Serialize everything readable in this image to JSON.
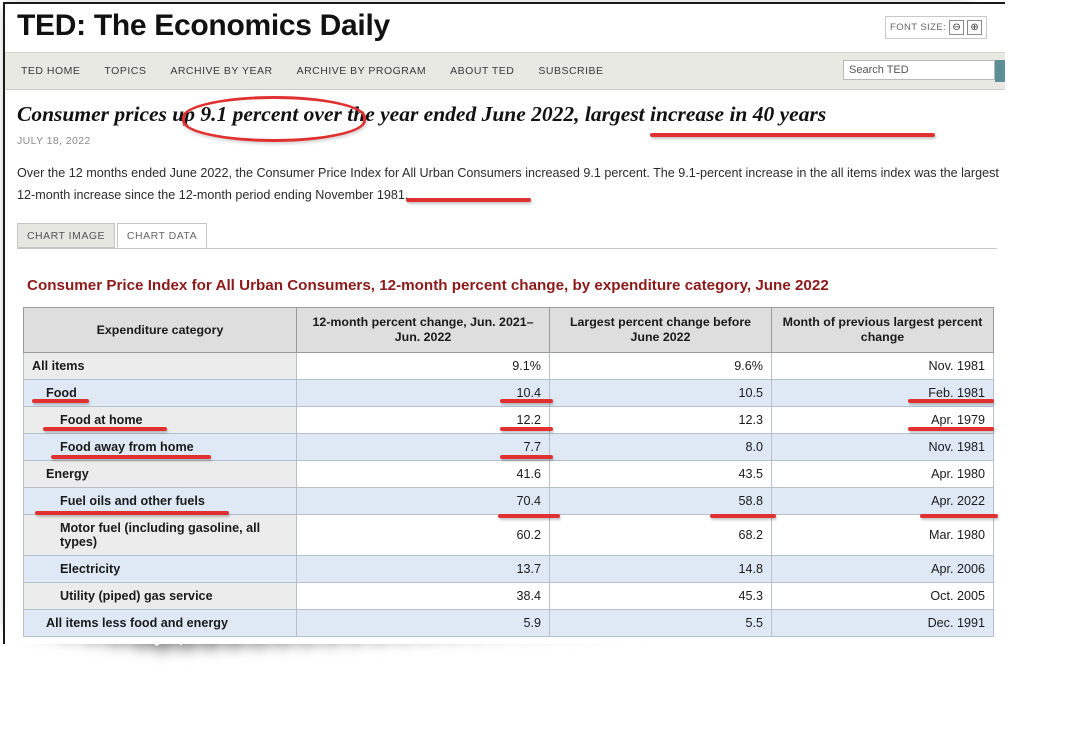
{
  "site": {
    "title": "TED: The Economics Daily",
    "font_size_label": "FONT SIZE:",
    "font_size_decrease": "⊖",
    "font_size_increase": "⊕",
    "nav": [
      "TED HOME",
      "TOPICS",
      "ARCHIVE BY YEAR",
      "ARCHIVE BY PROGRAM",
      "ABOUT TED",
      "SUBSCRIBE"
    ],
    "search": {
      "value": "Search TED",
      "placeholder": "Search TED",
      "button_icon": "search-icon",
      "button_glyph": "◔"
    }
  },
  "article": {
    "headline": "Consumer prices up 9.1 percent over the year ended June 2022, largest increase in 40 years",
    "date": "JULY 18, 2022",
    "body": "Over the 12 months ended June 2022, the Consumer Price Index for All Urban Consumers increased 9.1 percent. The 9.1-percent increase in the all items index was the largest 12-month increase since the 12-month period ending November 1981."
  },
  "tabs": [
    {
      "label": "CHART IMAGE",
      "active": false
    },
    {
      "label": "CHART DATA",
      "active": true
    }
  ],
  "chart_data": {
    "type": "table",
    "title": "Consumer Price Index for All Urban Consumers, 12-month percent change, by expenditure category, June 2022",
    "columns": [
      "Expenditure category",
      "12-month percent change, Jun. 2021–Jun. 2022",
      "Largest percent change before June 2022",
      "Month of previous largest percent change"
    ],
    "rows": [
      {
        "category": "All items",
        "indent": 0,
        "change": "9.1%",
        "largest": "9.6%",
        "month": "Nov. 1981"
      },
      {
        "category": "Food",
        "indent": 1,
        "change": "10.4",
        "largest": "10.5",
        "month": "Feb. 1981"
      },
      {
        "category": "Food at home",
        "indent": 2,
        "change": "12.2",
        "largest": "12.3",
        "month": "Apr. 1979"
      },
      {
        "category": "Food away from home",
        "indent": 2,
        "change": "7.7",
        "largest": "8.0",
        "month": "Nov. 1981"
      },
      {
        "category": "Energy",
        "indent": 1,
        "change": "41.6",
        "largest": "43.5",
        "month": "Apr. 1980"
      },
      {
        "category": "Fuel oils and other fuels",
        "indent": 2,
        "change": "70.4",
        "largest": "58.8",
        "month": "Apr. 2022"
      },
      {
        "category": "Motor fuel (including gasoline, all types)",
        "indent": 2,
        "change": "60.2",
        "largest": "68.2",
        "month": "Mar. 1980"
      },
      {
        "category": "Electricity",
        "indent": 2,
        "change": "13.7",
        "largest": "14.8",
        "month": "Apr. 2006"
      },
      {
        "category": "Utility (piped) gas service",
        "indent": 2,
        "change": "38.4",
        "largest": "45.3",
        "month": "Oct. 2005"
      },
      {
        "category": "All items less food and energy",
        "indent": 1,
        "change": "5.9",
        "largest": "5.5",
        "month": "Dec. 1991"
      }
    ]
  },
  "annotations": {
    "accent_color": "#e03030",
    "marks": [
      "ellipse-9-1-percent",
      "underline-largest-increase-in-40-years",
      "underline-november-1981",
      "underline-food",
      "underline-food-at-home",
      "underline-food-away-from-home",
      "underline-fuel-oils-and-other-fuels",
      "underline-10-4",
      "underline-12-2",
      "underline-7-7",
      "underline-70-4",
      "underline-58-8",
      "underline-feb-1981",
      "underline-apr-1979",
      "underline-apr-2022"
    ]
  }
}
